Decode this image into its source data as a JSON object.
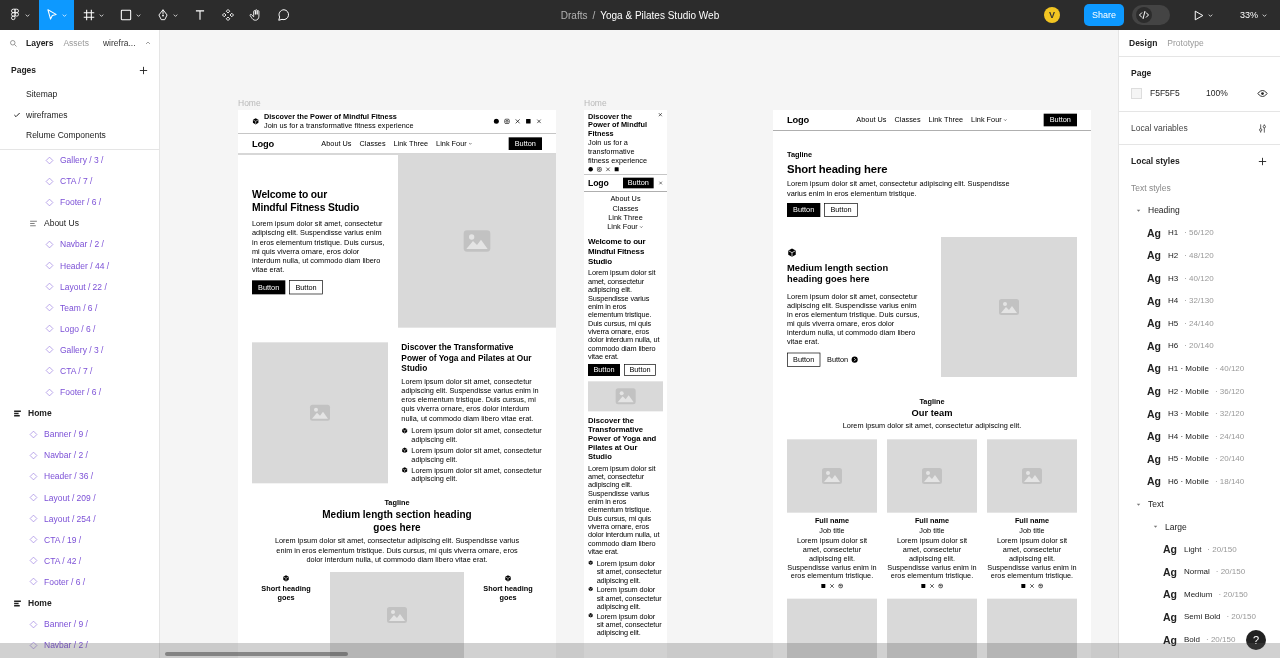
{
  "toolbar": {
    "tools": [
      {
        "kind": "figma-menu",
        "selected": false,
        "dropdown": true
      },
      {
        "kind": "move",
        "selected": true,
        "dropdown": true
      },
      {
        "kind": "frame",
        "selected": false,
        "dropdown": true
      },
      {
        "kind": "shape",
        "selected": false,
        "dropdown": true
      },
      {
        "kind": "pen",
        "selected": false,
        "dropdown": true
      },
      {
        "kind": "text",
        "selected": false,
        "dropdown": false
      },
      {
        "kind": "components",
        "selected": false,
        "dropdown": false
      },
      {
        "kind": "hand",
        "selected": false,
        "dropdown": false
      },
      {
        "kind": "comment",
        "selected": false,
        "dropdown": false
      }
    ],
    "breadcrumb": {
      "folder": "Drafts",
      "separator": "/",
      "file": "Yoga & Pilates Studio Web"
    },
    "avatar": "V",
    "share": "Share",
    "dev_mode": false,
    "zoom": "33%"
  },
  "layers_panel": {
    "tabs": [
      {
        "label": "Layers",
        "selected": true
      },
      {
        "label": "Assets",
        "selected": false
      }
    ],
    "page_picker": "wirefra...",
    "pages": {
      "title": "Pages",
      "items": [
        {
          "label": "Sitemap",
          "selected": false
        },
        {
          "label": "wireframes",
          "selected": true
        },
        {
          "label": "Relume Components",
          "selected": false
        }
      ]
    },
    "layers": [
      {
        "children": [
          {
            "children": [
              {
                "name": "Gallery / 3 /",
                "kind": "instance"
              },
              {
                "name": "CTA / 7 /",
                "kind": "instance"
              },
              {
                "name": "Footer / 6 /",
                "kind": "instance"
              }
            ]
          },
          {
            "name": "About Us",
            "kind": "frame",
            "children": [
              {
                "name": "Navbar / 2 /",
                "kind": "instance"
              },
              {
                "name": "Header / 44 /",
                "kind": "instance"
              },
              {
                "name": "Layout / 22 /",
                "kind": "instance"
              },
              {
                "name": "Team / 6 /",
                "kind": "instance"
              },
              {
                "name": "Logo / 6 /",
                "kind": "instance"
              },
              {
                "name": "Gallery / 3 /",
                "kind": "instance"
              },
              {
                "name": "CTA / 7 /",
                "kind": "instance"
              },
              {
                "name": "Footer / 6 /",
                "kind": "instance"
              }
            ]
          }
        ]
      },
      {
        "name": "Home",
        "kind": "section",
        "children": [
          {
            "name": "Banner / 9 /",
            "kind": "instance"
          },
          {
            "name": "Navbar / 2 /",
            "kind": "instance"
          },
          {
            "name": "Header / 36 /",
            "kind": "instance"
          },
          {
            "name": "Layout / 209 /",
            "kind": "instance"
          },
          {
            "name": "Layout / 254 /",
            "kind": "instance"
          },
          {
            "name": "CTA / 19 /",
            "kind": "instance"
          },
          {
            "name": "CTA / 42 /",
            "kind": "instance"
          },
          {
            "name": "Footer / 6 /",
            "kind": "instance"
          }
        ]
      },
      {
        "name": "Home",
        "kind": "section",
        "children": [
          {
            "name": "Banner / 9 /",
            "kind": "instance"
          },
          {
            "name": "Navbar / 2 /",
            "kind": "instance"
          }
        ]
      }
    ]
  },
  "canvas": {
    "frames": [
      {
        "kind": "desktop-home",
        "label": "Home",
        "banner": {
          "title": "Discover the Power of Mindful Fitness",
          "subtitle": "Join us for a transformative fitness experience"
        },
        "navbar": {
          "logo": "Logo",
          "links": [
            {
              "label": "About Us",
              "dropdown": false
            },
            {
              "label": "Classes",
              "dropdown": false
            },
            {
              "label": "Link Three",
              "dropdown": false
            },
            {
              "label": "Link Four",
              "dropdown": true
            }
          ],
          "button": "Button"
        },
        "header": {
          "heading": "Welcome to our\nMindful Fitness Studio",
          "text": "Lorem ipsum dolor sit amet, consectetur adipiscing elit. Suspendisse varius enim in eros elementum tristique. Duis cursus, mi quis viverra ornare, eros dolor interdum nulla, ut commodo diam libero vitae erat.",
          "buttons": [
            {
              "label": "Button",
              "kind": "primary"
            },
            {
              "label": "Button",
              "kind": "secondary"
            }
          ]
        },
        "feature": {
          "heading": "Discover the Transformative\nPower of Yoga and Pilates at Our\nStudio",
          "text": "Lorem ipsum dolor sit amet, consectetur adipiscing elit. Suspendisse varius enim in eros elementum tristique. Duis cursus, mi quis viverra ornare, eros dolor interdum nulla, ut commodo diam libero vitae erat.",
          "items": [
            "Lorem ipsum dolor sit amet, consectetur adipiscing elit.",
            "Lorem ipsum dolor sit amet, consectetur adipiscing elit.",
            "Lorem ipsum dolor sit amet, consectetur adipiscing elit."
          ]
        },
        "section": {
          "tagline": "Tagline",
          "heading": "Medium length section heading\ngoes here",
          "text": "Lorem ipsum dolor sit amet, consectetur adipiscing elit. Suspendisse varius enim in eros elementum tristique. Duis cursus, mi quis viverra ornare, eros dolor interdum nulla, ut commodo diam libero vitae erat.",
          "cards": [
            {
              "kind": "feature",
              "heading": "Short heading goes"
            },
            {
              "kind": "image"
            },
            {
              "kind": "feature",
              "heading": "Short heading goes"
            }
          ]
        }
      },
      {
        "kind": "mobile-home",
        "label": "Home",
        "banner": {
          "title": "Discover the Power of Mindful Fitness",
          "subtitle": "Join us for a transformative fitness experience"
        },
        "navbar": {
          "logo": "Logo",
          "button": "Button"
        },
        "menu": [
          {
            "label": "About Us",
            "dropdown": false
          },
          {
            "label": "Classes",
            "dropdown": false
          },
          {
            "label": "Link Three",
            "dropdown": false
          },
          {
            "label": "Link Four",
            "dropdown": true
          }
        ],
        "header": {
          "heading": "Welcome to our\nMindful Fitness\nStudio",
          "text": "Lorem ipsum dolor sit amet, consectetur adipiscing elit. Suspendisse varius enim in eros elementum tristique. Duis cursus, mi quis viverra ornare, eros dolor interdum nulla, ut commodo diam libero vitae erat.",
          "buttons": [
            {
              "label": "Button",
              "kind": "primary"
            },
            {
              "label": "Button",
              "kind": "secondary"
            }
          ]
        },
        "feature": {
          "heading": "Discover the Transformative Power of Yoga and Pilates at Our Studio",
          "text": "Lorem ipsum dolor sit amet, consectetur adipiscing elit. Suspendisse varius enim in eros elementum tristique. Duis cursus, mi quis viverra ornare, eros dolor interdum nulla, ut commodo diam libero vitae erat.",
          "items": [
            "Lorem ipsum dolor sit amet, consectetur adipiscing elit.",
            "Lorem ipsum dolor sit amet, consectetur adipiscing elit.",
            "Lorem ipsum dolor sit amet, consectetur adipiscing elit."
          ]
        }
      },
      {
        "kind": "desktop-about",
        "navbar": {
          "logo": "Logo",
          "links": [
            {
              "label": "About Us",
              "dropdown": false
            },
            {
              "label": "Classes",
              "dropdown": false
            },
            {
              "label": "Link Three",
              "dropdown": false
            },
            {
              "label": "Link Four",
              "dropdown": true
            }
          ],
          "button": "Button"
        },
        "hero": {
          "tagline": "Tagline",
          "heading": "Short heading here",
          "text": "Lorem ipsum dolor sit amet, consectetur adipiscing elit. Suspendisse varius enim in eros elementum tristique.",
          "buttons": [
            {
              "label": "Button",
              "kind": "primary"
            },
            {
              "label": "Button",
              "kind": "secondary"
            }
          ]
        },
        "layout": {
          "heading": "Medium length section\nheading goes here",
          "text": "Lorem ipsum dolor sit amet, consectetur adipiscing elit. Suspendisse varius enim in eros elementum tristique. Duis cursus, mi quis viverra ornare, eros dolor interdum nulla, ut commodo diam libero vitae erat.",
          "buttons": [
            {
              "label": "Button",
              "kind": "secondary"
            },
            {
              "label": "Button",
              "kind": "link"
            }
          ]
        },
        "team": {
          "tagline": "Tagline",
          "heading": "Our team",
          "text": "Lorem ipsum dolor sit amet, consectetur adipiscing elit.",
          "members": [
            {
              "name": "Full name",
              "title": "Job title",
              "text": "Lorem ipsum dolor sit amet, consectetur adipiscing elit. Suspendisse varius enim in eros elementum tristique."
            },
            {
              "name": "Full name",
              "title": "Job title",
              "text": "Lorem ipsum dolor sit amet, consectetur adipiscing elit. Suspendisse varius enim in eros elementum tristique."
            },
            {
              "name": "Full name",
              "title": "Job title",
              "text": "Lorem ipsum dolor sit amet, consectetur adipiscing elit. Suspendisse varius enim in eros elementum tristique."
            }
          ],
          "more": [
            {
              "kind": "image"
            },
            {
              "kind": "image"
            },
            {
              "kind": "image"
            }
          ]
        }
      }
    ]
  },
  "design_panel": {
    "tabs": [
      {
        "label": "Design",
        "selected": true
      },
      {
        "label": "Prototype",
        "selected": false
      }
    ],
    "page": {
      "title": "Page",
      "color": "F5F5F5",
      "opacity": "100%"
    },
    "local_variables": "Local variables",
    "local_styles": "Local styles",
    "text_styles": {
      "title": "Text styles",
      "groups": [
        {
          "label": "Heading",
          "expanded": true,
          "children": [
            {
              "sample": "Ag",
              "name": "H1",
              "spec": "· 56/120"
            },
            {
              "sample": "Ag",
              "name": "H2",
              "spec": "· 48/120"
            },
            {
              "sample": "Ag",
              "name": "H3",
              "spec": "· 40/120"
            },
            {
              "sample": "Ag",
              "name": "H4",
              "spec": "· 32/130"
            },
            {
              "sample": "Ag",
              "name": "H5",
              "spec": "· 24/140"
            },
            {
              "sample": "Ag",
              "name": "H6",
              "spec": "· 20/140"
            },
            {
              "sample": "Ag",
              "name": "H1 · Mobile",
              "spec": "· 40/120"
            },
            {
              "sample": "Ag",
              "name": "H2 · Mobile",
              "spec": "· 36/120"
            },
            {
              "sample": "Ag",
              "name": "H3 · Mobile",
              "spec": "· 32/120"
            },
            {
              "sample": "Ag",
              "name": "H4 · Mobile",
              "spec": "· 24/140"
            },
            {
              "sample": "Ag",
              "name": "H5 · Mobile",
              "spec": "· 20/140"
            },
            {
              "sample": "Ag",
              "name": "H6 · Mobile",
              "spec": "· 18/140"
            }
          ]
        },
        {
          "label": "Text",
          "expanded": true,
          "children": [
            {
              "label": "Large",
              "expanded": true,
              "children": [
                {
                  "sample": "Ag",
                  "name": "Light",
                  "spec": "· 20/150"
                },
                {
                  "sample": "Ag",
                  "name": "Normal",
                  "spec": "· 20/150"
                },
                {
                  "sample": "Ag",
                  "name": "Medium",
                  "spec": "· 20/150"
                },
                {
                  "sample": "Ag",
                  "name": "Semi Bold",
                  "spec": "· 20/150"
                },
                {
                  "sample": "Ag",
                  "name": "Bold",
                  "spec": "· 20/150"
                }
              ]
            }
          ]
        }
      ]
    }
  },
  "help": "?"
}
